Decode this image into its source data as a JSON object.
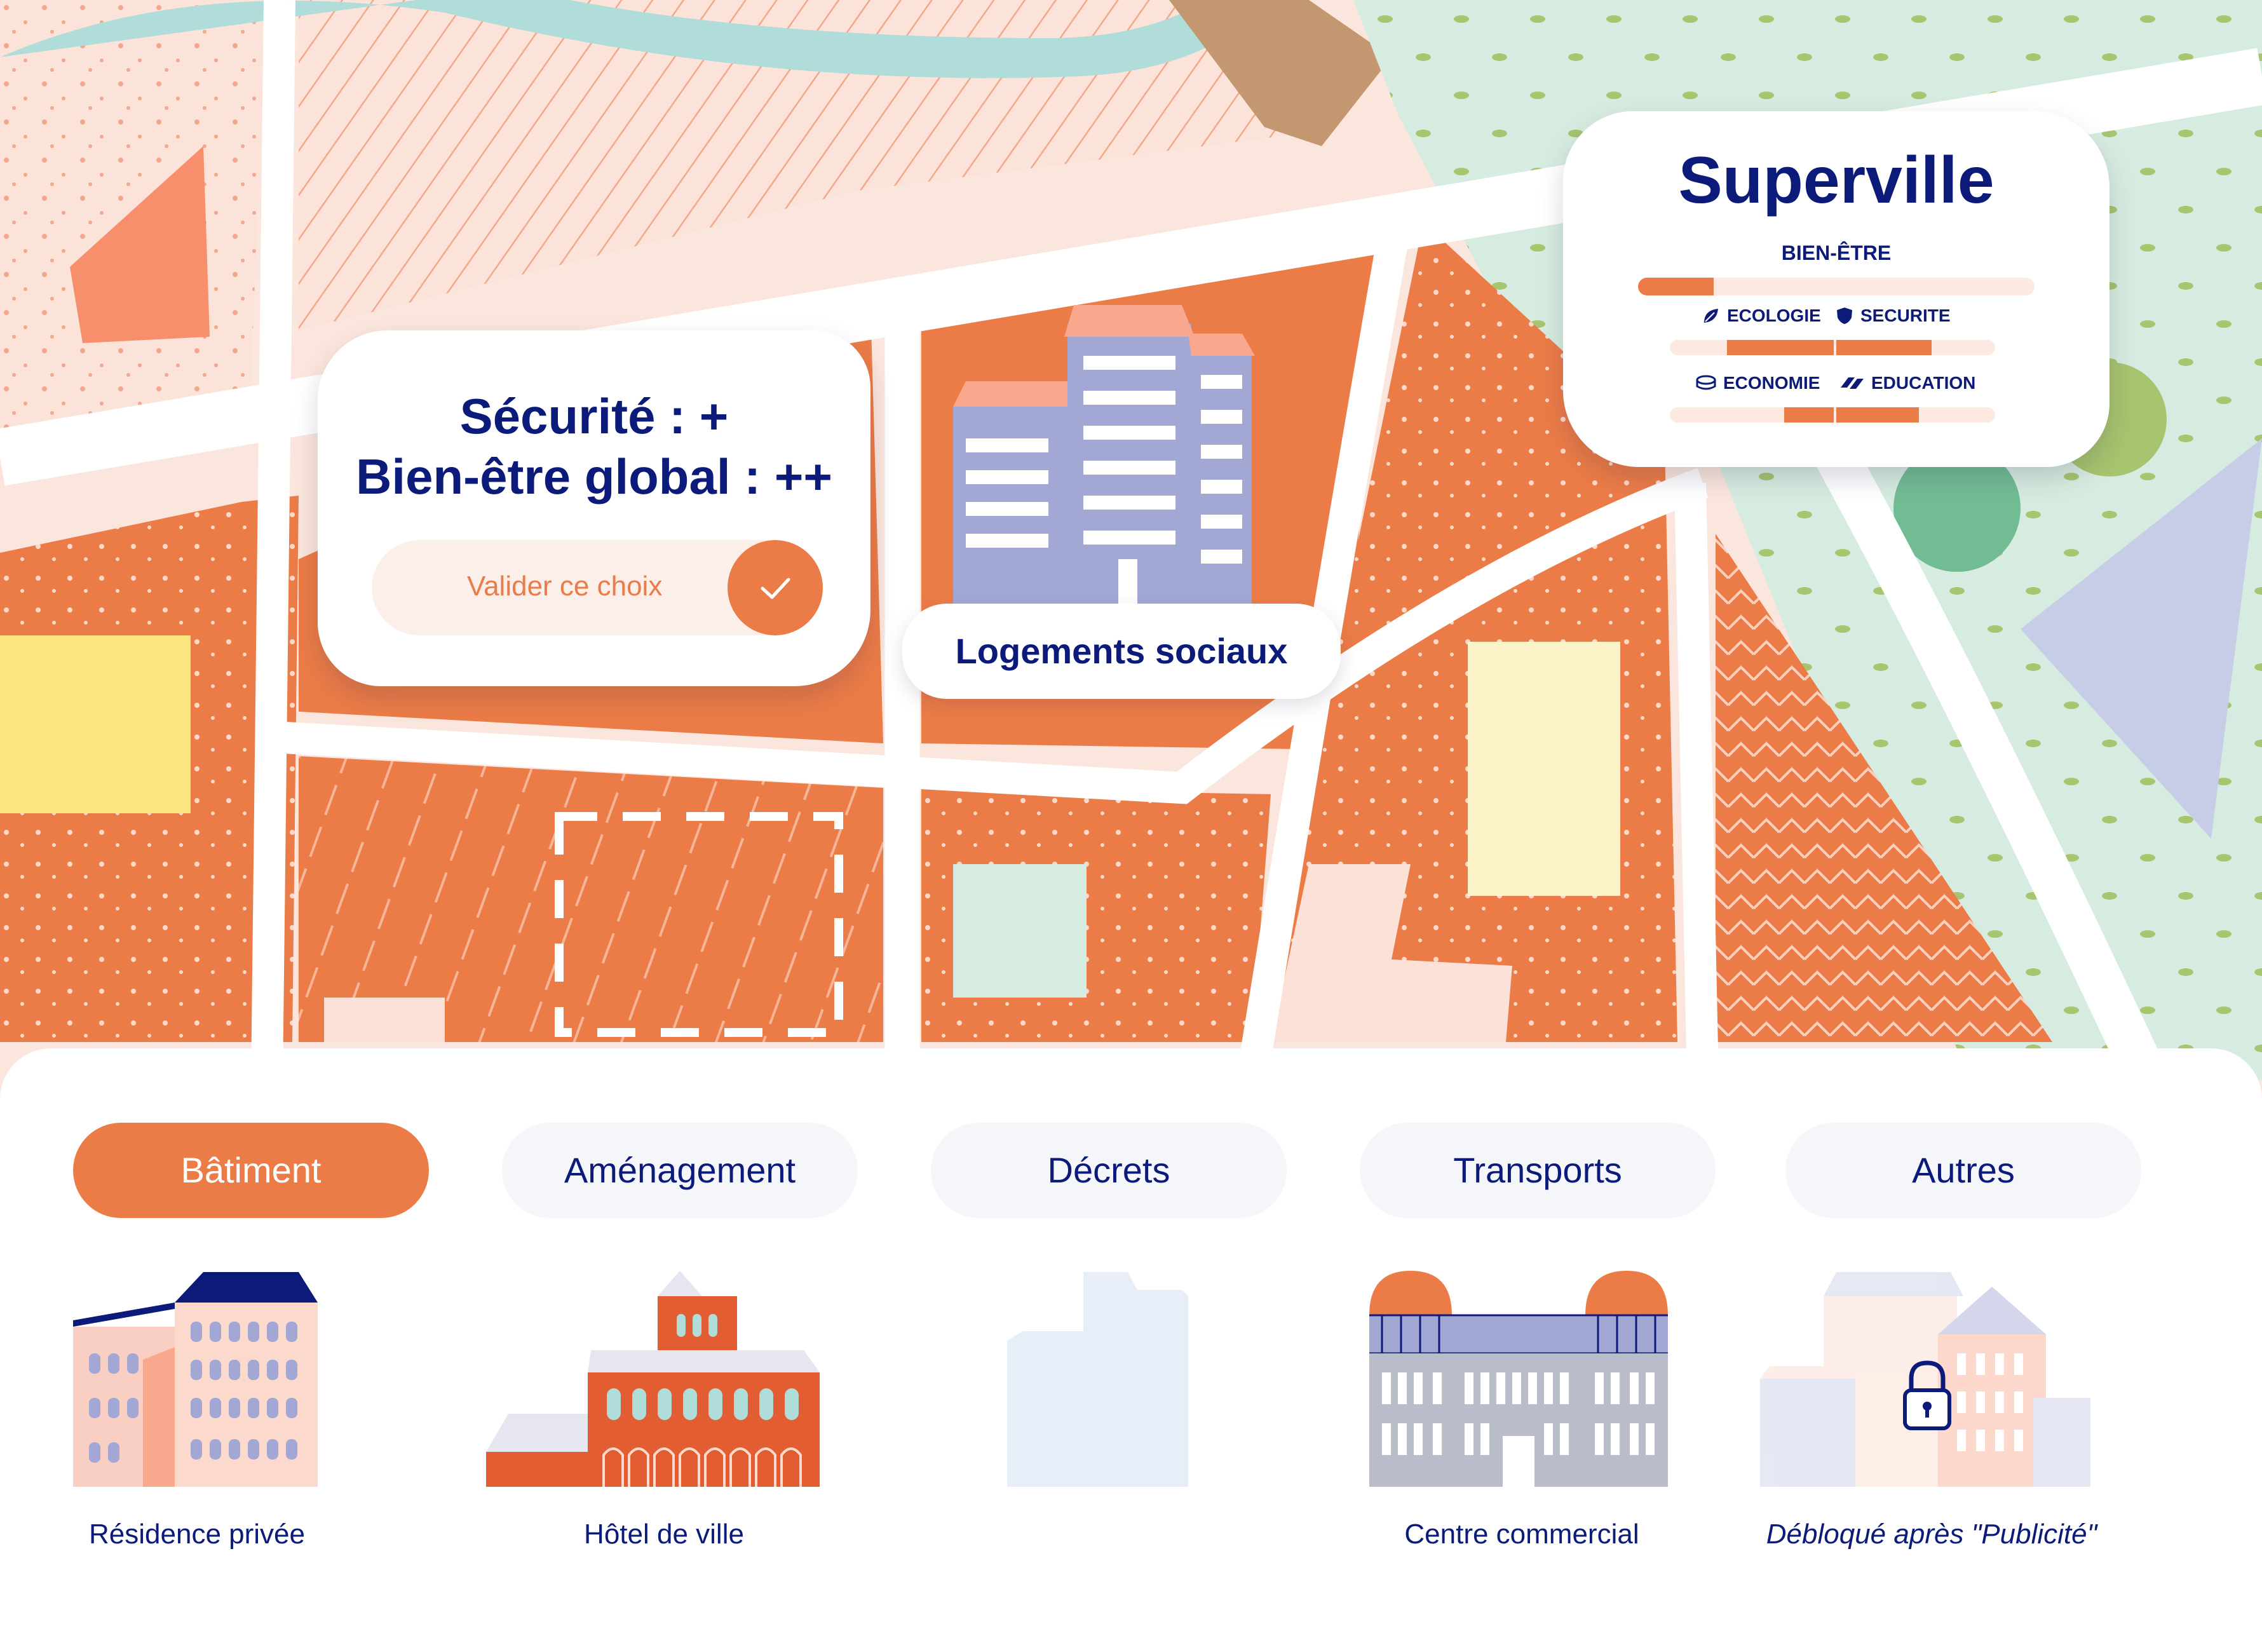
{
  "choice_panel": {
    "line1": "Sécurité : +",
    "line2": "Bien-être global : ++",
    "validate_label": "Valider ce choix"
  },
  "building_label": "Logements sociaux",
  "city": {
    "name": "Superville",
    "wellbeing_label": "BIEN-ÊTRE",
    "wellbeing_level": 0.19,
    "stats": [
      {
        "label": "ECOLOGIE",
        "icon": "leaf-icon"
      },
      {
        "label": "SECURITE",
        "icon": "shield-icon"
      },
      {
        "label": "ECONOMIE",
        "icon": "coins-icon"
      },
      {
        "label": "EDUCATION",
        "icon": "books-icon"
      }
    ]
  },
  "tabs": [
    {
      "label": "Bâtiment",
      "active": true
    },
    {
      "label": "Aménagement",
      "active": false
    },
    {
      "label": "Décrets",
      "active": false
    },
    {
      "label": "Transports",
      "active": false
    },
    {
      "label": "Autres",
      "active": false
    }
  ],
  "buildings": [
    {
      "name": "Résidence privée",
      "locked": false
    },
    {
      "name": "Hôtel de ville",
      "locked": false
    },
    {
      "name": "",
      "locked": false
    },
    {
      "name": "Centre commercial",
      "locked": false
    },
    {
      "name": "Débloqué après \"Publicité\"",
      "locked": true
    }
  ],
  "colors": {
    "accent": "#ec7c47",
    "navy": "#0c1a7a",
    "river": "#b0dcd9",
    "park": "#d7ece0"
  }
}
